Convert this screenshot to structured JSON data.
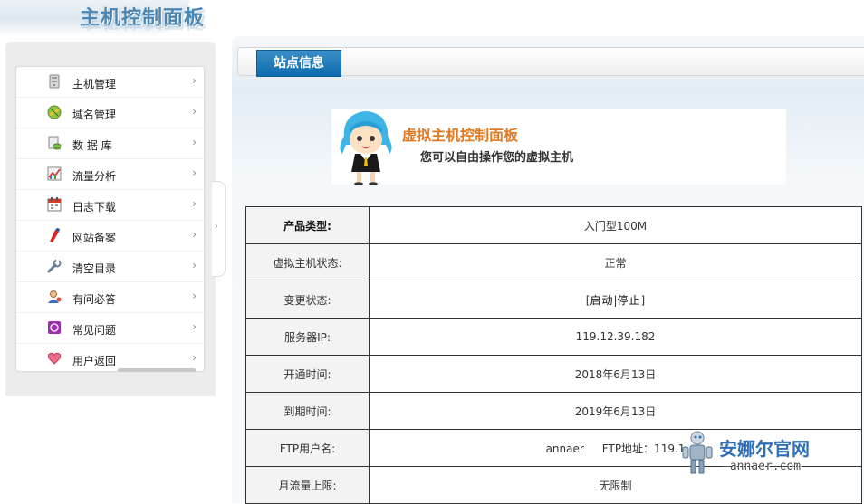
{
  "header": {
    "logo_text": "主机控制面板"
  },
  "sidebar": {
    "items": [
      {
        "label": "主机管理",
        "icon": "server-icon"
      },
      {
        "label": "域名管理",
        "icon": "globe-icon"
      },
      {
        "label": "数 据 库",
        "icon": "database-icon"
      },
      {
        "label": "流量分析",
        "icon": "chart-icon"
      },
      {
        "label": "日志下载",
        "icon": "calendar-icon"
      },
      {
        "label": "网站备案",
        "icon": "pen-icon"
      },
      {
        "label": "清空目录",
        "icon": "wrench-icon"
      },
      {
        "label": "有问必答",
        "icon": "user-icon"
      },
      {
        "label": "常见问题",
        "icon": "question-icon"
      },
      {
        "label": "用户返回",
        "icon": "heart-icon"
      }
    ],
    "chevron": "›"
  },
  "tab": {
    "label": "站点信息"
  },
  "banner": {
    "title": "虚拟主机控制面板",
    "subtitle": "您可以自由操作您的虚拟主机"
  },
  "info": {
    "rows": [
      {
        "key": "产品类型:",
        "value": "入门型100M"
      },
      {
        "key": "虚拟主机状态:",
        "value": "正常"
      },
      {
        "key": "变更状态:",
        "value": ""
      },
      {
        "key": "服务器IP:",
        "value": "119.12.39.182"
      },
      {
        "key": "开通时间:",
        "value": "2018年6月13日"
      },
      {
        "key": "到期时间:",
        "value": "2019年6月13日"
      },
      {
        "key": "FTP用户名:",
        "value": ""
      },
      {
        "key": "月流量上限:",
        "value": "无限制"
      }
    ],
    "control": {
      "open": "[",
      "start": "启动",
      "sep": "|",
      "stop": "停止",
      "close": "]"
    },
    "ftp_user": "annaer",
    "ftp_addr": "FTP地址：119.1"
  },
  "watermark": {
    "title": "安娜尔官网",
    "url": "—annaer.com"
  },
  "colors": {
    "tab_blue": "#0d6bae",
    "banner_orange": "#e27a22",
    "logo_blue": "#4b87b4"
  }
}
